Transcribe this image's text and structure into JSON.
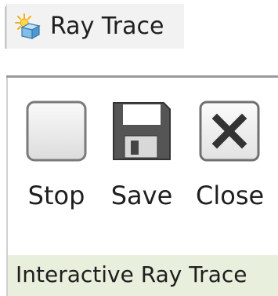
{
  "top_button": {
    "label": "Ray Trace",
    "icon": "ray-trace-icon"
  },
  "panel": {
    "title": "Interactive Ray Trace",
    "tools": [
      {
        "label": "Stop",
        "icon": "stop-icon"
      },
      {
        "label": "Save",
        "icon": "floppy-save-icon"
      },
      {
        "label": "Close",
        "icon": "close-x-icon"
      }
    ]
  },
  "colors": {
    "panel_title_bg": "#e8efdc",
    "top_button_bg": "#f2f2f2"
  }
}
